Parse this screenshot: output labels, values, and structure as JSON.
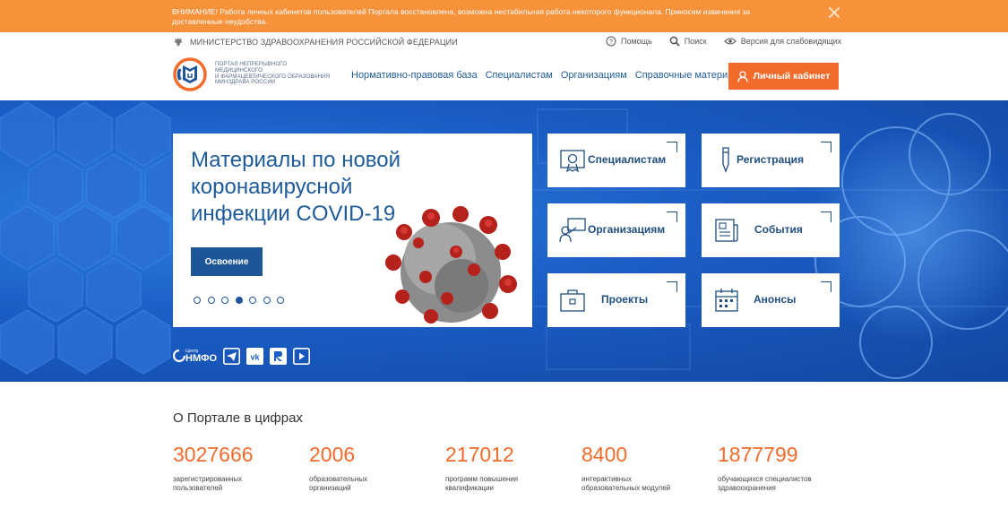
{
  "alert": {
    "text": "ВНИМАНИЕ! Работа личных кабинетов пользователей Портала восстановлена, возможна нестабильная работа некоторого функционала. Приносим извинения за доставленные неудобства."
  },
  "topbar": {
    "ministry": "МИНИСТЕРСТВО ЗДРАВООХРАНЕНИЯ РОССИЙСКОЙ ФЕДЕРАЦИИ",
    "help": "Помощь",
    "search": "Поиск",
    "accessibility": "Версия для слабовидящих"
  },
  "header": {
    "logo_lines": [
      "ПОРТАЛ НЕПРЕРЫВНОГО",
      "МЕДИЦИНСКОГО",
      "И ФАРМАЦЕВТИЧЕСКОГО ОБРАЗОВАНИЯ",
      "МИНЗДРАВА РОССИИ"
    ],
    "nav": [
      "Нормативно-правовая база",
      "Специалистам",
      "Организациям",
      "Справочные материалы"
    ],
    "cabinet_button": "Личный кабинет"
  },
  "hero": {
    "slide_title": "Материалы по новой коронавирусной инфекции COVID-19",
    "slide_button": "Освоение",
    "slides_count": 7,
    "active_slide": 4,
    "tiles": [
      {
        "label": "Специалистам",
        "icon": "certificate-icon"
      },
      {
        "label": "Регистрация",
        "icon": "pen-icon"
      },
      {
        "label": "Организациям",
        "icon": "lecturer-icon"
      },
      {
        "label": "События",
        "icon": "newspaper-icon"
      },
      {
        "label": "Проекты",
        "icon": "briefcase-icon"
      },
      {
        "label": "Анонсы",
        "icon": "calendar-icon"
      }
    ],
    "nmfo_small": "Центр",
    "nmfo": "НМФО"
  },
  "stats": {
    "title": "О Портале в цифрах",
    "items": [
      {
        "value": "3027666",
        "label": "зарегистрированных пользователей"
      },
      {
        "value": "2006",
        "label": "образовательных организаций"
      },
      {
        "value": "217012",
        "label": "программ повышения квалификации"
      },
      {
        "value": "8400",
        "label": "интерактивных образовательных модулей"
      },
      {
        "value": "1877799",
        "label": "обучающихся специалистов здравоохранения"
      }
    ]
  },
  "colors": {
    "alert": "#f7913a",
    "accent": "#f26b2b",
    "primary": "#1e5599",
    "hero": "#1a5dc4"
  }
}
